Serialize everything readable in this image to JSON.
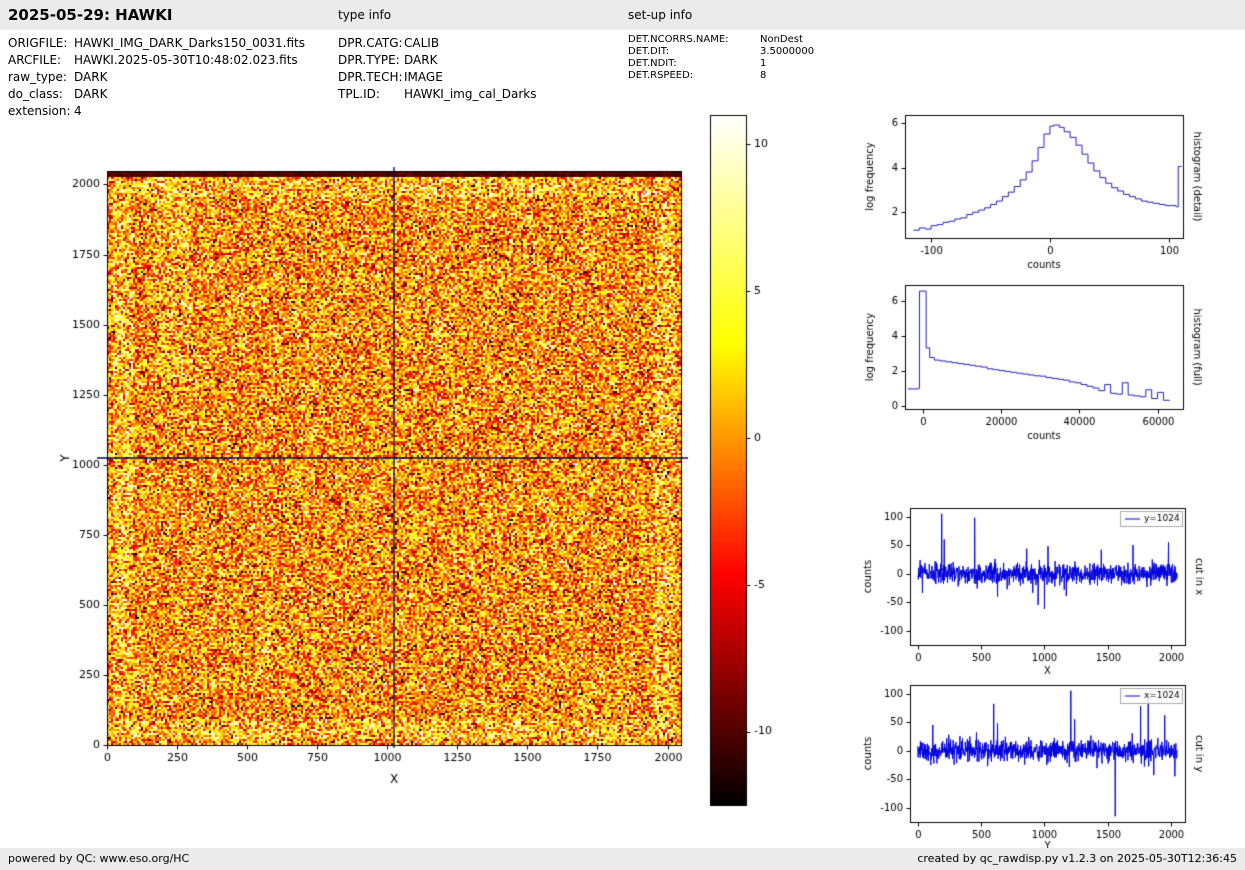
{
  "header": {
    "title": "2025-05-29: HAWKI",
    "type_info_label": "type info",
    "setup_info_label": "set-up info"
  },
  "file_info": {
    "rows": [
      {
        "label": "ORIGFILE:",
        "value": "HAWKI_IMG_DARK_Darks150_0031.fits"
      },
      {
        "label": "ARCFILE:",
        "value": "HAWKI.2025-05-30T10:48:02.023.fits"
      },
      {
        "label": "raw_type:",
        "value": "DARK"
      },
      {
        "label": "do_class:",
        "value": "DARK"
      },
      {
        "label": "extension:",
        "value": "4"
      }
    ]
  },
  "type_info": {
    "rows": [
      {
        "label": "DPR.CATG:",
        "value": "CALIB"
      },
      {
        "label": "DPR.TYPE:",
        "value": "DARK"
      },
      {
        "label": "DPR.TECH:",
        "value": "IMAGE"
      },
      {
        "label": "TPL.ID:",
        "value": "HAWKI_img_cal_Darks"
      }
    ]
  },
  "setup_info": {
    "rows": [
      {
        "label": "DET.NCORRS.NAME:",
        "value": "NonDest"
      },
      {
        "label": "DET.DIT:",
        "value": "3.5000000"
      },
      {
        "label": "DET.NDIT:",
        "value": "1"
      },
      {
        "label": "DET.RSPEED:",
        "value": "8"
      }
    ]
  },
  "footer": {
    "left": "powered by QC: www.eso.org/HC",
    "right": "created by qc_rawdisp.py v1.2.3 on 2025-05-30T12:36:45"
  },
  "chart_data": [
    {
      "id": "detector_image",
      "type": "heatmap",
      "description": "2048x2048 HAWKI raw dark frame shown with hot colormap; noisy speckle field with bright ring near detector edges, dark band at very top, bright vertical structure near x=180-290 for y>1300, crosshair cursor lines at x=1024 and y=1024",
      "xlabel": "X",
      "ylabel": "Y",
      "xlim": [
        0,
        2048
      ],
      "ylim": [
        0,
        2048
      ],
      "xticks": [
        0,
        250,
        500,
        750,
        1000,
        1250,
        1500,
        1750,
        2000
      ],
      "yticks": [
        0,
        250,
        500,
        750,
        1000,
        1250,
        1500,
        1750,
        2000
      ],
      "colormap": "hot",
      "vmin": -12.5,
      "vmax": 11,
      "crosshair": {
        "x": 1024,
        "y": 1024,
        "color": "#000050"
      }
    },
    {
      "id": "colorbar",
      "type": "colorbar",
      "colormap": "hot",
      "vmin": -12.5,
      "vmax": 11,
      "ticks": [
        10,
        5,
        0,
        -5,
        -10
      ]
    },
    {
      "id": "histogram_detail",
      "type": "line",
      "step": true,
      "side_label": "histogram (detail)",
      "xlabel": "counts",
      "ylabel": "log frequency",
      "xlim": [
        -122,
        112
      ],
      "ylim": [
        0.85,
        6.35
      ],
      "xticks": [
        -100,
        0,
        100
      ],
      "yticks": [
        2,
        4,
        6
      ],
      "color": "#2222c0",
      "points": [
        [
          -115,
          1.2
        ],
        [
          -110,
          1.3
        ],
        [
          -105,
          1.25
        ],
        [
          -100,
          1.4
        ],
        [
          -95,
          1.45
        ],
        [
          -90,
          1.55
        ],
        [
          -85,
          1.6
        ],
        [
          -80,
          1.7
        ],
        [
          -75,
          1.75
        ],
        [
          -70,
          1.9
        ],
        [
          -65,
          2.0
        ],
        [
          -60,
          2.1
        ],
        [
          -55,
          2.2
        ],
        [
          -50,
          2.35
        ],
        [
          -45,
          2.5
        ],
        [
          -40,
          2.7
        ],
        [
          -35,
          2.9
        ],
        [
          -30,
          3.15
        ],
        [
          -25,
          3.45
        ],
        [
          -20,
          3.8
        ],
        [
          -15,
          4.3
        ],
        [
          -10,
          4.9
        ],
        [
          -5,
          5.5
        ],
        [
          0,
          5.85
        ],
        [
          3,
          5.9
        ],
        [
          8,
          5.8
        ],
        [
          12,
          5.6
        ],
        [
          17,
          5.35
        ],
        [
          22,
          5.0
        ],
        [
          27,
          4.6
        ],
        [
          32,
          4.2
        ],
        [
          37,
          3.85
        ],
        [
          42,
          3.55
        ],
        [
          47,
          3.3
        ],
        [
          52,
          3.1
        ],
        [
          57,
          2.95
        ],
        [
          62,
          2.8
        ],
        [
          67,
          2.7
        ],
        [
          72,
          2.6
        ],
        [
          77,
          2.5
        ],
        [
          82,
          2.45
        ],
        [
          87,
          2.4
        ],
        [
          92,
          2.35
        ],
        [
          97,
          2.3
        ],
        [
          102,
          2.3
        ],
        [
          106,
          2.25
        ],
        [
          108,
          4.05
        ],
        [
          111,
          4.05
        ]
      ]
    },
    {
      "id": "histogram_full",
      "type": "line",
      "step": true,
      "side_label": "histogram (full)",
      "xlabel": "counts",
      "ylabel": "log frequency",
      "xlim": [
        -4500,
        66500
      ],
      "ylim": [
        -0.2,
        6.9
      ],
      "xticks": [
        0,
        20000,
        40000,
        60000
      ],
      "yticks": [
        0,
        2,
        4,
        6
      ],
      "color": "#2222c0",
      "points": [
        [
          -3800,
          0.95
        ],
        [
          -1000,
          1.0
        ],
        [
          -800,
          6.55
        ],
        [
          400,
          6.55
        ],
        [
          900,
          3.3
        ],
        [
          1800,
          2.75
        ],
        [
          3000,
          2.6
        ],
        [
          4500,
          2.55
        ],
        [
          6000,
          2.5
        ],
        [
          7500,
          2.45
        ],
        [
          9000,
          2.4
        ],
        [
          10500,
          2.35
        ],
        [
          12000,
          2.3
        ],
        [
          13500,
          2.25
        ],
        [
          15000,
          2.2
        ],
        [
          16500,
          2.1
        ],
        [
          18000,
          2.05
        ],
        [
          19500,
          2.0
        ],
        [
          21000,
          1.95
        ],
        [
          22500,
          1.9
        ],
        [
          24000,
          1.85
        ],
        [
          25500,
          1.8
        ],
        [
          27000,
          1.75
        ],
        [
          28500,
          1.7
        ],
        [
          30000,
          1.68
        ],
        [
          31500,
          1.6
        ],
        [
          33000,
          1.55
        ],
        [
          34500,
          1.5
        ],
        [
          36000,
          1.45
        ],
        [
          37500,
          1.35
        ],
        [
          39000,
          1.3
        ],
        [
          40500,
          1.2
        ],
        [
          42000,
          1.1
        ],
        [
          43500,
          1.0
        ],
        [
          45000,
          0.85
        ],
        [
          46500,
          1.2
        ],
        [
          48000,
          0.7
        ],
        [
          49500,
          0.65
        ],
        [
          51000,
          1.3
        ],
        [
          52500,
          0.6
        ],
        [
          54000,
          0.55
        ],
        [
          55500,
          0.5
        ],
        [
          57000,
          0.9
        ],
        [
          58500,
          0.4
        ],
        [
          60000,
          0.75
        ],
        [
          61500,
          0.3
        ],
        [
          63000,
          0.25
        ]
      ]
    },
    {
      "id": "cut_x",
      "type": "line",
      "side_label": "cut in x",
      "xlabel": "X",
      "ylabel": "counts",
      "legend": "y=1024",
      "xlim": [
        -60,
        2110
      ],
      "ylim": [
        -125,
        115
      ],
      "xticks": [
        0,
        500,
        1000,
        1500,
        2000
      ],
      "yticks": [
        -100,
        -50,
        0,
        50,
        100
      ],
      "color": "#0000dd",
      "noise": {
        "sigma": 9,
        "n": 1024,
        "seed": 7
      },
      "spikes": [
        [
          190,
          105
        ],
        [
          210,
          60
        ],
        [
          450,
          98
        ],
        [
          630,
          -40
        ],
        [
          950,
          -55
        ],
        [
          1000,
          -62
        ],
        [
          1030,
          48
        ],
        [
          1450,
          42
        ],
        [
          1700,
          50
        ],
        [
          1980,
          55
        ]
      ]
    },
    {
      "id": "cut_y",
      "type": "line",
      "side_label": "cut in y",
      "xlabel": "Y",
      "ylabel": "counts",
      "legend": "x=1024",
      "xlim": [
        -60,
        2110
      ],
      "ylim": [
        -125,
        115
      ],
      "xticks": [
        0,
        500,
        1000,
        1500,
        2000
      ],
      "yticks": [
        -100,
        -50,
        0,
        50,
        100
      ],
      "color": "#0000dd",
      "noise": {
        "sigma": 9,
        "n": 1024,
        "seed": 11
      },
      "spikes": [
        [
          120,
          45
        ],
        [
          600,
          82
        ],
        [
          630,
          48
        ],
        [
          1210,
          105
        ],
        [
          1240,
          55
        ],
        [
          1560,
          -115
        ],
        [
          1760,
          78
        ],
        [
          1820,
          95
        ],
        [
          1950,
          62
        ],
        [
          2030,
          -45
        ]
      ]
    }
  ]
}
